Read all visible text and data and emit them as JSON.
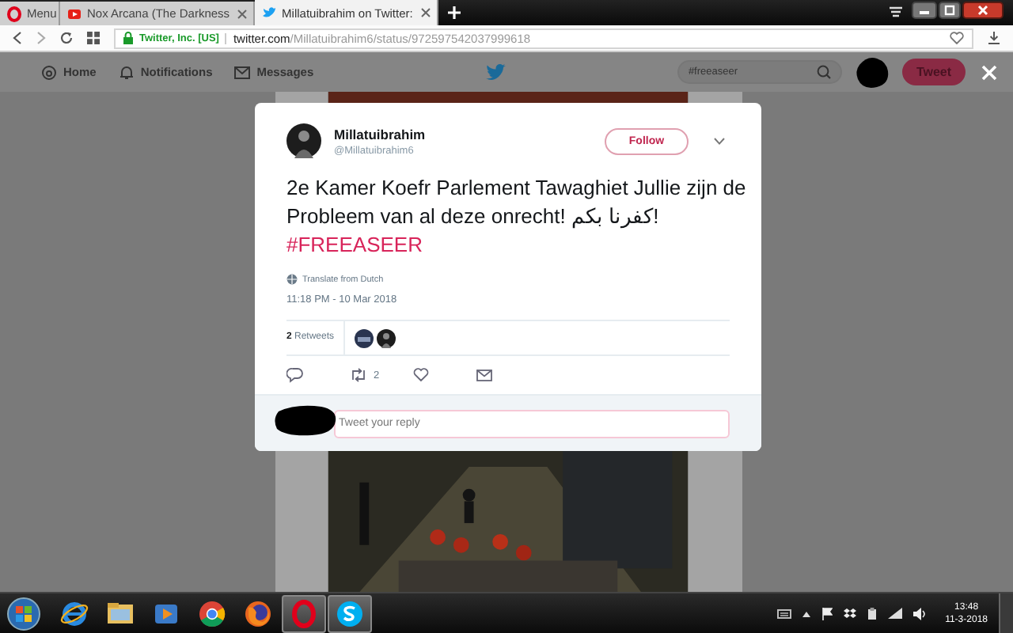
{
  "browser": {
    "tabs": [
      {
        "label": "Menu",
        "kind": "menu",
        "selected": false
      },
      {
        "label": "Nox Arcana (The Darkness",
        "kind": "video",
        "selected": false
      },
      {
        "label": "Millatuibrahim on Twitter:",
        "kind": "bird",
        "selected": true
      }
    ],
    "security": "Twitter, Inc. [US]",
    "url_domain": "twitter.com",
    "url_path": "/Millatuibrahim6/status/972597542037999618"
  },
  "nav": {
    "items": [
      {
        "label": "Home",
        "kind": "home"
      },
      {
        "label": "Notifications",
        "kind": "bell"
      },
      {
        "label": "Messages",
        "kind": "mail"
      }
    ],
    "search": {
      "value": "#freeaseer"
    },
    "tweet_button": "Tweet"
  },
  "tweet": {
    "name": "Millatuibrahim",
    "handle": "@Millatuibrahim6",
    "follow": "Follow",
    "text": "2e Kamer Koefr Parlement Tawaghiet  Jullie zijn de Probleem van al deze onrecht! كفرنا بكم!",
    "hashtag": "#FREEASEER",
    "translate": "Translate from Dutch",
    "time": "11:18 PM - 10 Mar 2018",
    "retweets": "**2** Retweets",
    "actions": [
      {
        "kind": "reply"
      },
      {
        "kind": "retweet",
        "count": "2"
      },
      {
        "kind": "like"
      },
      {
        "kind": "message"
      }
    ],
    "reply_placeholder": "Tweet your reply"
  },
  "taskbar": {
    "apps": [
      {
        "kind": "ie",
        "active": false
      },
      {
        "kind": "folder",
        "active": false
      },
      {
        "kind": "media",
        "active": false
      },
      {
        "kind": "chrome",
        "active": false
      },
      {
        "kind": "firefox",
        "active": false
      },
      {
        "kind": "opera",
        "active": true
      },
      {
        "kind": "skype",
        "active": true
      }
    ],
    "time": "13:48",
    "date": "11-3-2018"
  }
}
